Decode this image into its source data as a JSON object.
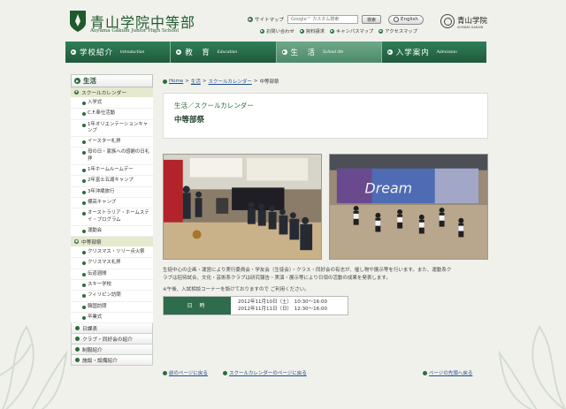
{
  "header": {
    "school_name": "青山学院中等部",
    "school_sub": "Aoyama Gakuin Junior High School",
    "sitemap": "サイトマップ",
    "search_placeholder": "Google™ カスタム検索",
    "search_button": "検索",
    "english": "English",
    "quick_links": [
      "お問い合わせ",
      "資料請求",
      "キャンパスマップ",
      "アクセスマップ"
    ],
    "corp_name": "青山学院",
    "corp_sub": "AOYAMA GAKUIN"
  },
  "nav": [
    {
      "jp": "学校紹介",
      "en": "Introduction"
    },
    {
      "jp": "教　育",
      "en": "Education"
    },
    {
      "jp": "生　活",
      "en": "School life"
    },
    {
      "jp": "入学案内",
      "en": "Admission"
    }
  ],
  "sidebar": {
    "heading": "生活",
    "section1": "スクールカレンダー",
    "items1": [
      "入学式",
      "C.F.奉仕活動",
      "1年オリエンテーションキャンプ",
      "イースター礼拝",
      "母の日・家族への感謝の日礼拝",
      "1年ホームルームデー",
      "2年富士五湖キャンプ",
      "3年沖縄旅行",
      "標高キャンプ",
      "オーストラリア・ホームステイ・プログラム",
      "運動会"
    ],
    "section2": "中等部祭",
    "items2": [
      "クリスマス・ツリー点火祭",
      "クリスマス礼拝",
      "伝道週間",
      "スキー学校",
      "フィリピン訪問",
      "韓国訪問",
      "卒業式"
    ],
    "bottom": [
      "日課表",
      "クラブ・同好会の紹介",
      "制服紹介",
      "施設・設備紹介"
    ]
  },
  "main": {
    "breadcrumb": [
      "Home",
      "生活",
      "スクールカレンダー",
      "中等部祭"
    ],
    "category": "生活／スクールカレンダー",
    "title": "中等部祭",
    "banner_text": "Dream",
    "description_lines": [
      "生徒中心の企画・運営により実行委員会・学友会（生徒会）・クラス・同好会の有志が、催し物や展示等を行います。また、運動系ク",
      "ラブは招待試合、文化・芸術系クラブは研究報告・実演・展示等により日頃の活動の成果を発表します。"
    ],
    "note": "※午後、入試相談コーナーを設けておりますので ご利用ください。",
    "date_label": "日 時",
    "dates": [
      "2012年11月10日（土）　10:30〜16:00",
      "2012年11月11日（日）　12:30〜16:00"
    ]
  },
  "footer_links": {
    "prev": "前のページに戻る",
    "calendar": "スクールカレンダーのページに戻る",
    "top": "ページの先頭へ戻る"
  },
  "colors": {
    "accent": "#2f7550",
    "sidebar_highlight": "#e5e9ce",
    "background": "#f1f1ec",
    "link": "#1f4f8f"
  }
}
